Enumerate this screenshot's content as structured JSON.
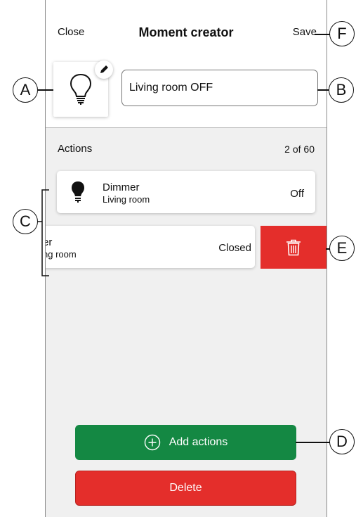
{
  "header": {
    "close_label": "Close",
    "title": "Moment creator",
    "save_label": "Save"
  },
  "moment": {
    "icon": "light-bulb-icon",
    "edit_icon": "pencil-icon",
    "name_value": "Living room OFF"
  },
  "actions": {
    "label": "Actions",
    "count": "2 of 60",
    "items": [
      {
        "icon": "light-bulb-filled-icon",
        "title": "Dimmer",
        "subtitle": "Living room",
        "state": "Off"
      },
      {
        "title": "er",
        "subtitle": "ng room",
        "state": "Closed",
        "delete_icon": "trash-icon"
      }
    ]
  },
  "buttons": {
    "add_actions_label": "Add actions",
    "add_icon": "plus-circle-icon",
    "delete_label": "Delete"
  },
  "callouts": [
    "A",
    "B",
    "C",
    "D",
    "E",
    "F"
  ],
  "colors": {
    "green": "#148843",
    "red": "#e42e2b",
    "background": "#f0f0f0"
  }
}
